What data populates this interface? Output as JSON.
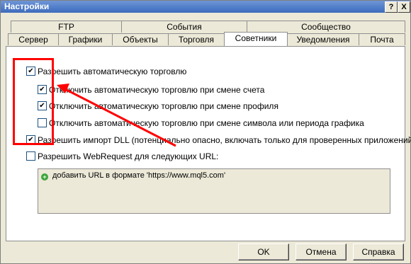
{
  "window": {
    "title": "Настройки"
  },
  "titlebar_buttons": {
    "help": "?",
    "close": "X"
  },
  "tabs_row1": [
    {
      "label": "FTP"
    },
    {
      "label": "События"
    },
    {
      "label": "Сообщество"
    }
  ],
  "tabs_row2": [
    {
      "label": "Сервер"
    },
    {
      "label": "Графики"
    },
    {
      "label": "Объекты"
    },
    {
      "label": "Торговля"
    },
    {
      "label": "Советники",
      "active": true
    },
    {
      "label": "Уведомления"
    },
    {
      "label": "Почта"
    }
  ],
  "options": [
    {
      "label": "Разрешить автоматическую торговлю",
      "checked": true
    },
    {
      "label": "Отключить автоматическую торговлю при смене счета",
      "checked": true
    },
    {
      "label": "Отключить автоматическую торговлю при смене профиля",
      "checked": true
    },
    {
      "label": "Отключить автоматическую торговлю при смене символа или периода графика",
      "checked": false
    },
    {
      "label": "Разрешить импорт DLL (потенциально опасно, включать только для проверенных приложений)",
      "checked": true
    },
    {
      "label": "Разрешить WebRequest для следующих URL:",
      "checked": false
    }
  ],
  "url_list": {
    "add_text": "добавить URL в формате 'https://www.mql5.com'"
  },
  "buttons": {
    "ok": "OK",
    "cancel": "Отмена",
    "help": "Справка"
  },
  "annotation_color": "#ff0000"
}
